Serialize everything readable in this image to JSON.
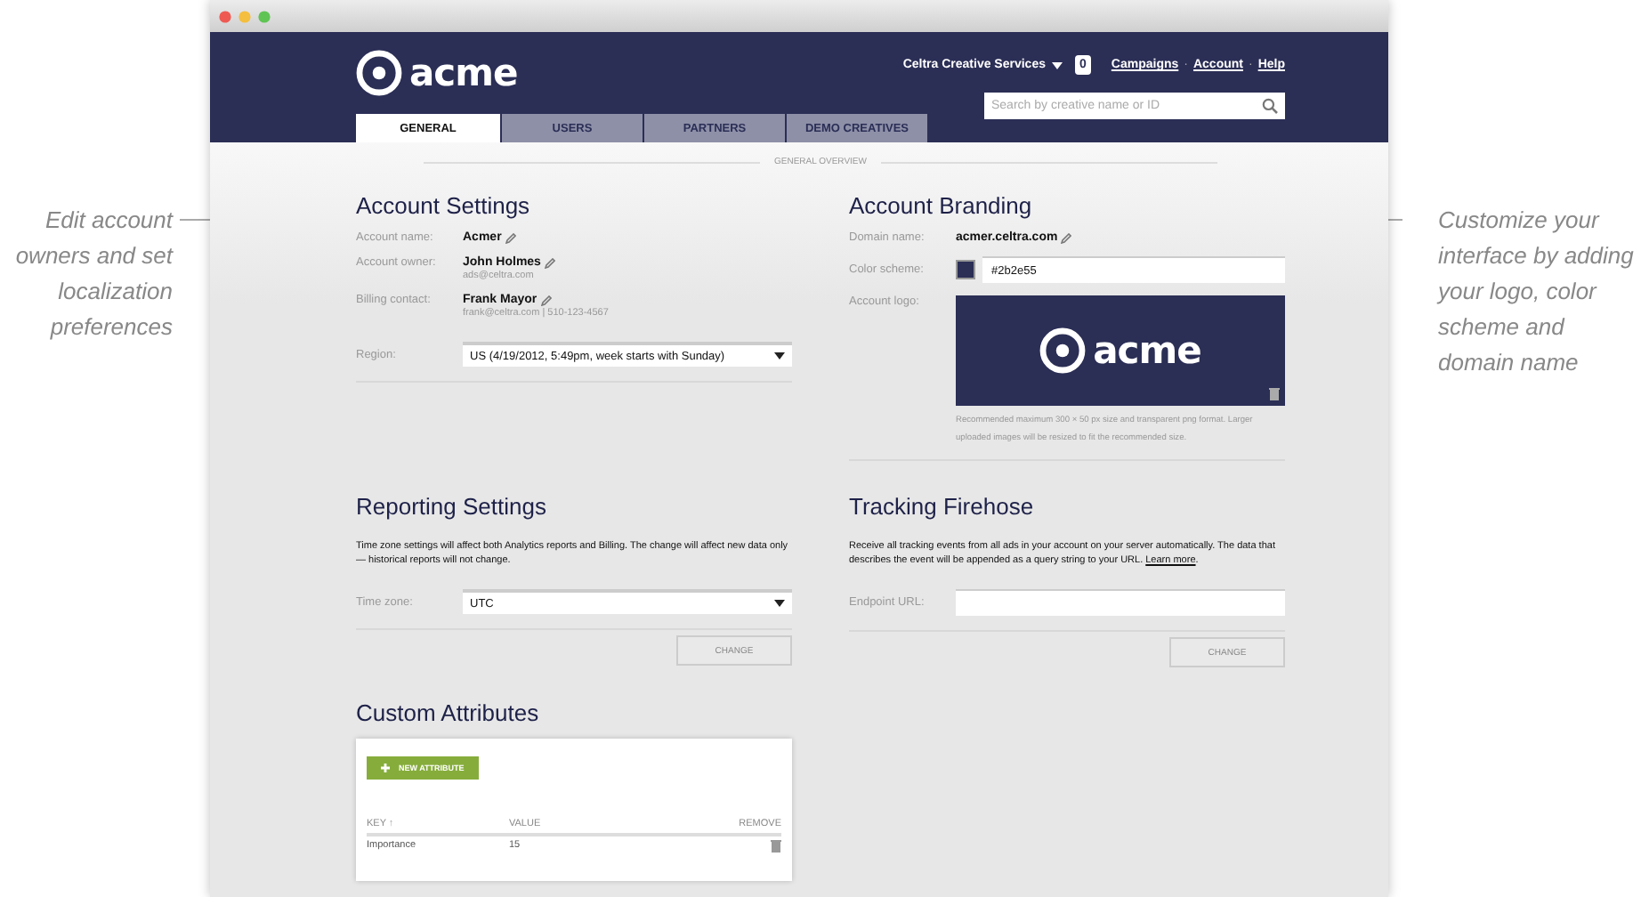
{
  "annotations": {
    "left": [
      "Edit account",
      "owners and set",
      "localization",
      "preferences"
    ],
    "right": [
      "Customize your",
      "interface by adding",
      "your logo, color",
      "scheme and",
      "domain name"
    ]
  },
  "header": {
    "logo_text": "acme",
    "account_menu": "Celtra Creative Services",
    "notification_count": "0",
    "links": [
      "Campaigns",
      "Account",
      "Help"
    ],
    "link_separator": "·",
    "search": {
      "placeholder": "Search by creative name or ID"
    }
  },
  "tabs": [
    {
      "label": "GENERAL",
      "selected": true
    },
    {
      "label": "USERS",
      "selected": false
    },
    {
      "label": "PARTNERS",
      "selected": false
    },
    {
      "label": "DEMO CREATIVES",
      "selected": false
    }
  ],
  "overview_label": "GENERAL OVERVIEW",
  "account_settings": {
    "title": "Account Settings",
    "rows": [
      {
        "label": "Account name:",
        "value": "Acmer",
        "detail": ""
      },
      {
        "label": "Account owner:",
        "value": "John Holmes",
        "detail": "ads@celtra.com"
      },
      {
        "label": "Billing contact:",
        "value": "Frank Mayor",
        "detail": "frank@celtra.com | 510-123-4567"
      }
    ],
    "region": {
      "label": "Region:",
      "value": "US (4/19/2012, 5:49pm, week starts with Sunday)"
    }
  },
  "account_branding": {
    "title": "Account Branding",
    "domain": {
      "label": "Domain name:",
      "value": "acmer.celtra.com"
    },
    "color_scheme": {
      "label": "Color scheme:",
      "value": "#2b2e55",
      "color": "#2b2e55"
    },
    "logo": {
      "label": "Account logo:",
      "logo_text": "acme"
    },
    "help": "Recommended maximum 300 × 50 px size and transparent png format. Larger uploaded images will be resized to fit the recommended size."
  },
  "reporting_settings": {
    "title": "Reporting Settings",
    "description": "Time zone settings will affect both Analytics reports and Billing. The change will affect new data only — historical reports will not change.",
    "timezone": {
      "label": "Time zone:",
      "value": "UTC"
    },
    "button": "CHANGE"
  },
  "tracking_firehose": {
    "title": "Tracking Firehose",
    "description": "Receive all tracking events from all ads in your account on your server automatically. The data that describes the event will be appended as a query string to your URL.",
    "link": "Learn more",
    "link_suffix": ".",
    "endpoint": {
      "label": "Endpoint URL:"
    },
    "button": "CHANGE"
  },
  "custom_attributes": {
    "title": "Custom Attributes",
    "new_button": "NEW ATTRIBUTE",
    "columns": [
      "KEY",
      "VALUE",
      "REMOVE"
    ],
    "sort_mark": "↑",
    "rows": [
      {
        "key": "Importance",
        "value": "15"
      }
    ]
  }
}
